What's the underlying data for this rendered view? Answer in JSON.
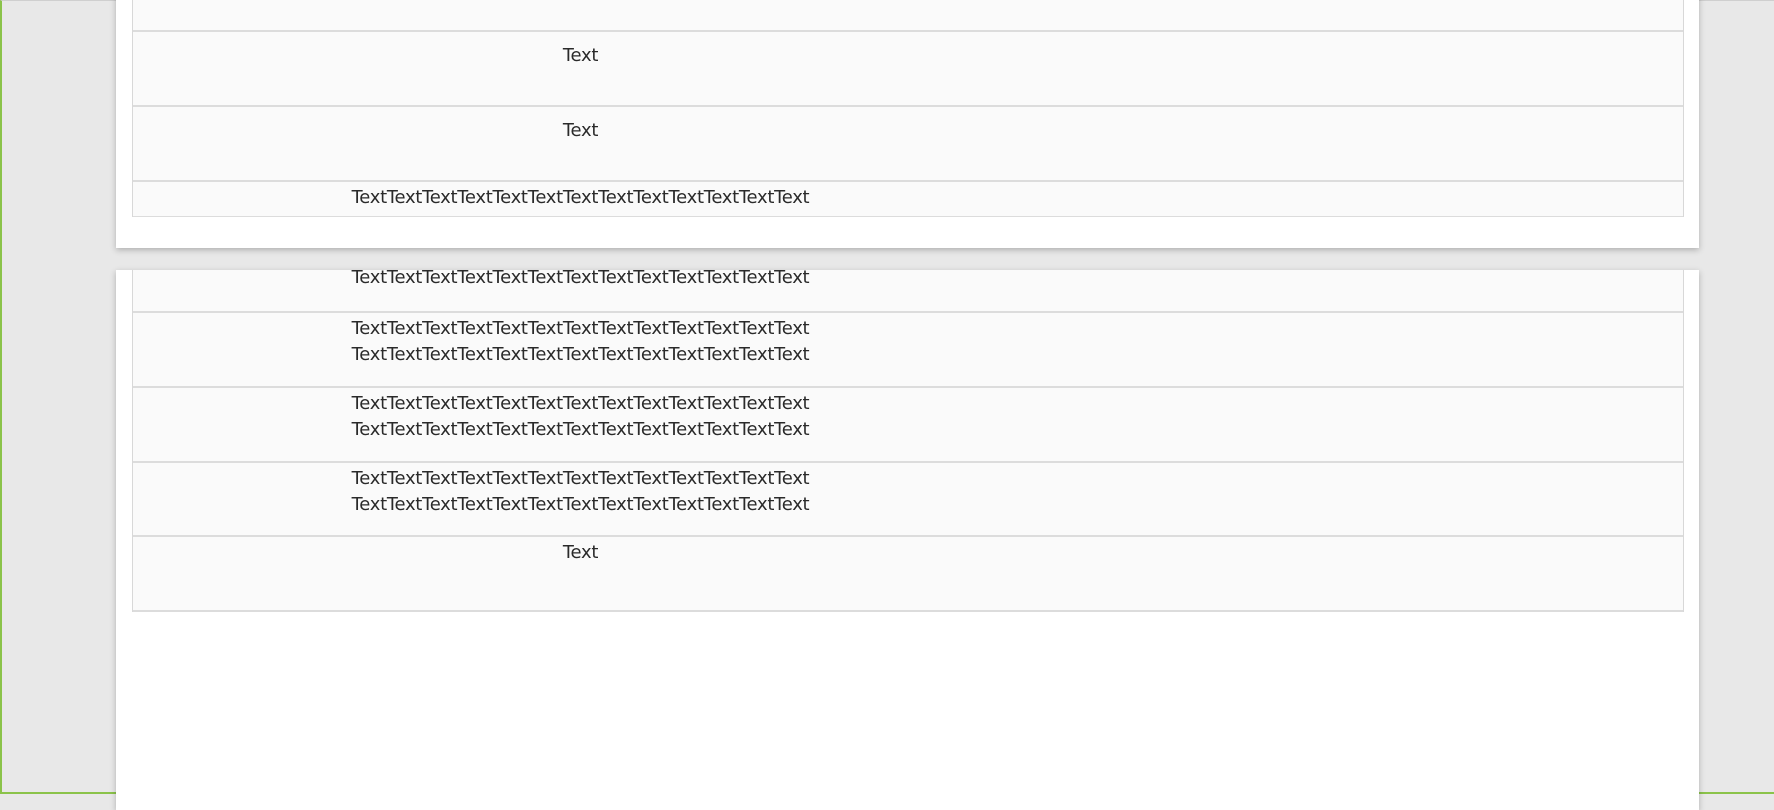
{
  "pages": [
    {
      "rows": [
        {
          "text": ""
        },
        {
          "text": "Text"
        },
        {
          "text": "Text"
        },
        {
          "text": "TextTextTextTextTextTextTextTextTextTextTextTextText"
        }
      ]
    },
    {
      "rows": [
        {
          "text": "TextTextTextTextTextTextTextTextTextTextTextTextText"
        },
        {
          "text": "TextTextTextTextTextTextTextTextTextTextTextTextText\nTextTextTextTextTextTextTextTextTextTextTextTextText"
        },
        {
          "text": "TextTextTextTextTextTextTextTextTextTextTextTextText\nTextTextTextTextTextTextTextTextTextTextTextTextText"
        },
        {
          "text": "TextTextTextTextTextTextTextTextTextTextTextTextText\nTextTextTextTextTextTextTextTextTextTextTextTextText"
        },
        {
          "text": "Text"
        }
      ]
    }
  ]
}
